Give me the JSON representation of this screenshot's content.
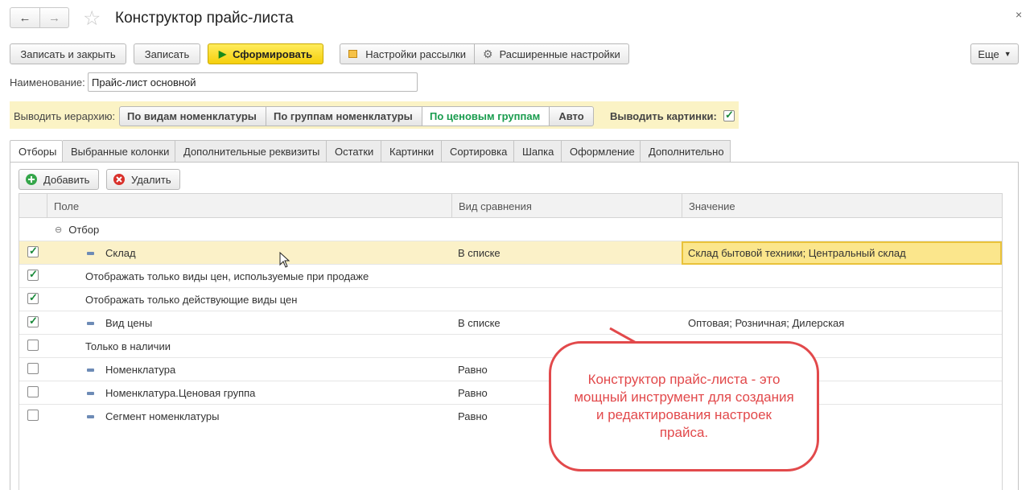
{
  "window": {
    "title": "Конструктор прайс-листа",
    "close_glyph": "×"
  },
  "toolbar": {
    "save_close": "Записать и закрыть",
    "save": "Записать",
    "generate": "Сформировать",
    "mailing_settings": "Настройки рассылки",
    "advanced_settings": "Расширенные настройки",
    "more": "Еще"
  },
  "name_field": {
    "label": "Наименование:",
    "value": "Прайс-лист основной"
  },
  "hierarchy": {
    "label": "Выводить иерархию:",
    "options": [
      "По видам номенклатуры",
      "По группам номенклатуры",
      "По ценовым группам",
      "Авто"
    ],
    "selected": "По ценовым группам",
    "show_pictures_label": "Выводить картинки:",
    "show_pictures": true
  },
  "tabs": [
    "Отборы",
    "Выбранные колонки",
    "Дополнительные реквизиты",
    "Остатки",
    "Картинки",
    "Сортировка",
    "Шапка",
    "Оформление",
    "Дополнительно"
  ],
  "active_tab": "Отборы",
  "filter_toolbar": {
    "add": "Добавить",
    "remove": "Удалить"
  },
  "table": {
    "columns": [
      "Поле",
      "Вид сравнения",
      "Значение"
    ],
    "group_label": "Отбор",
    "rows": [
      {
        "checked": true,
        "field": "Склад",
        "comparison": "В списке",
        "value": "Склад бытовой техники; Центральный склад",
        "selected": true
      },
      {
        "checked": true,
        "field": "Отображать только виды цен, используемые при продаже",
        "comparison": "",
        "value": ""
      },
      {
        "checked": true,
        "field": "Отображать только действующие виды цен",
        "comparison": "",
        "value": ""
      },
      {
        "checked": true,
        "field": "Вид цены",
        "comparison": "В списке",
        "value": "Оптовая; Розничная; Дилерская"
      },
      {
        "checked": false,
        "field": "Только в наличии",
        "comparison": "",
        "value": ""
      },
      {
        "checked": false,
        "field": "Номенклатура",
        "comparison": "Равно",
        "value": ""
      },
      {
        "checked": false,
        "field": "Номенклатура.Ценовая группа",
        "comparison": "Равно",
        "value": ""
      },
      {
        "checked": false,
        "field": "Сегмент номенклатуры",
        "comparison": "Равно",
        "value": ""
      }
    ]
  },
  "callout": {
    "text": "Конструктор прайс-листа - это мощный инструмент для создания и редактирования настроек прайса."
  },
  "colors": {
    "accent_yellow": "#f5cf0c",
    "band": "#fbf3c5",
    "selected_row": "#fbf1c8",
    "active_option": "#199c4e",
    "callout": "#e2494b"
  }
}
